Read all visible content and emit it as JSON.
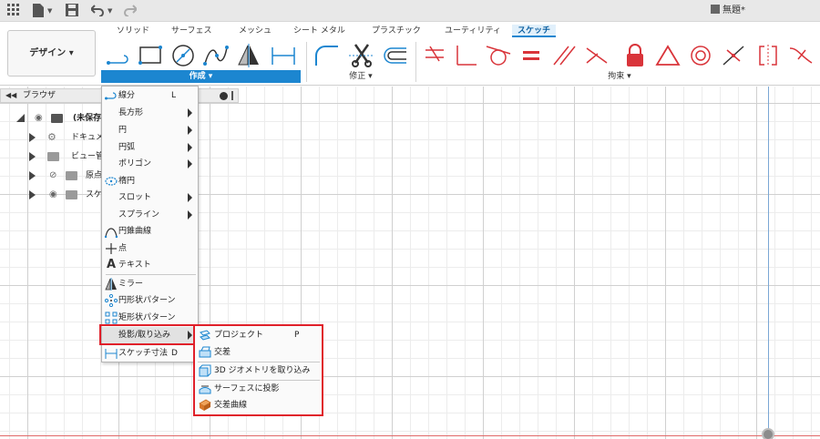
{
  "titlebar": {
    "document_title": "無題*"
  },
  "toolbar": {
    "workspace_label": "デザイン ▾",
    "tabs": [
      "ソリッド",
      "サーフェス",
      "メッシュ",
      "シート メタル",
      "プラスチック",
      "ユーティリティ",
      "スケッチ"
    ],
    "groups": {
      "create": "作成 ▾",
      "modify": "修正 ▾",
      "constraints": "拘束 ▾"
    },
    "colors": {
      "accent": "#1c86d0",
      "constraint_red": "#d9343a"
    }
  },
  "browser": {
    "title": "ブラウザ",
    "rows": [
      {
        "label": "(未保存)"
      },
      {
        "label": "ドキュメン"
      },
      {
        "label": "ビュー管理"
      },
      {
        "label": "原点"
      },
      {
        "label": "スケ"
      }
    ]
  },
  "menu": {
    "items": [
      {
        "label": "線分",
        "shortcut": "L",
        "icon": "line-icon"
      },
      {
        "label": "長方形",
        "icon": ""
      },
      {
        "label": "円",
        "icon": ""
      },
      {
        "label": "円弧",
        "icon": ""
      },
      {
        "label": "ポリゴン",
        "icon": ""
      },
      {
        "label": "楕円",
        "icon": "ellipse-icon"
      },
      {
        "label": "スロット",
        "icon": ""
      },
      {
        "label": "スプライン",
        "icon": ""
      },
      {
        "label": "円錐曲線",
        "icon": "conic-curve-icon"
      },
      {
        "label": "点",
        "icon": "point-icon"
      },
      {
        "label": "テキスト",
        "icon": "text-icon"
      },
      {
        "label": "ミラー",
        "icon": "mirror-icon"
      },
      {
        "label": "円形状パターン",
        "icon": "circular-pattern-icon"
      },
      {
        "label": "矩形状パターン",
        "icon": "rectangular-pattern-icon"
      },
      {
        "label": "投影/取り込み",
        "icon": ""
      },
      {
        "label": "スケッチ寸法",
        "shortcut": "D",
        "icon": "sketch-dimension-icon"
      }
    ]
  },
  "submenu": {
    "items": [
      {
        "label": "プロジェクト",
        "shortcut": "P",
        "icon": "project-icon"
      },
      {
        "label": "交差",
        "icon": "intersect-icon"
      },
      {
        "label": "3D ジオメトリを取り込み",
        "icon": "include-3d-geometry-icon"
      },
      {
        "label": "サーフェスに投影",
        "icon": "project-to-surface-icon"
      },
      {
        "label": "交差曲線",
        "icon": "intersection-curve-icon"
      }
    ]
  }
}
